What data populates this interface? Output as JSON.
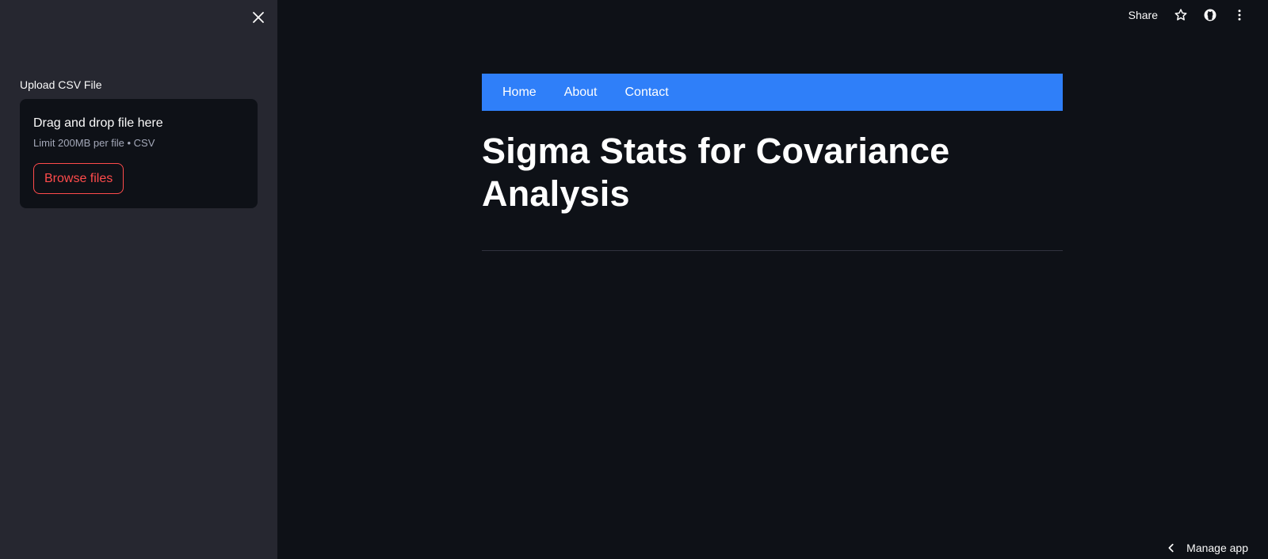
{
  "sidebar": {
    "close_icon": "close-icon",
    "uploader": {
      "label": "Upload CSV File",
      "dropzone_title": "Drag and drop file here",
      "dropzone_limit": "Limit 200MB per file • CSV",
      "browse_label": "Browse files"
    }
  },
  "toolbar": {
    "share_label": "Share",
    "icons": [
      "star-icon",
      "github-icon",
      "more-vertical-icon"
    ]
  },
  "navbar": {
    "color": "#2f7ff9",
    "items": [
      {
        "label": "Home"
      },
      {
        "label": "About"
      },
      {
        "label": "Contact"
      }
    ]
  },
  "main": {
    "title": "Sigma Stats for Covariance Analysis"
  },
  "footer": {
    "manage_label": "Manage app",
    "icon": "chevron-left-icon"
  },
  "colors": {
    "background": "#0e1117",
    "sidebar": "#262730",
    "accent": "#ff4b4b",
    "nav": "#2f7ff9"
  }
}
